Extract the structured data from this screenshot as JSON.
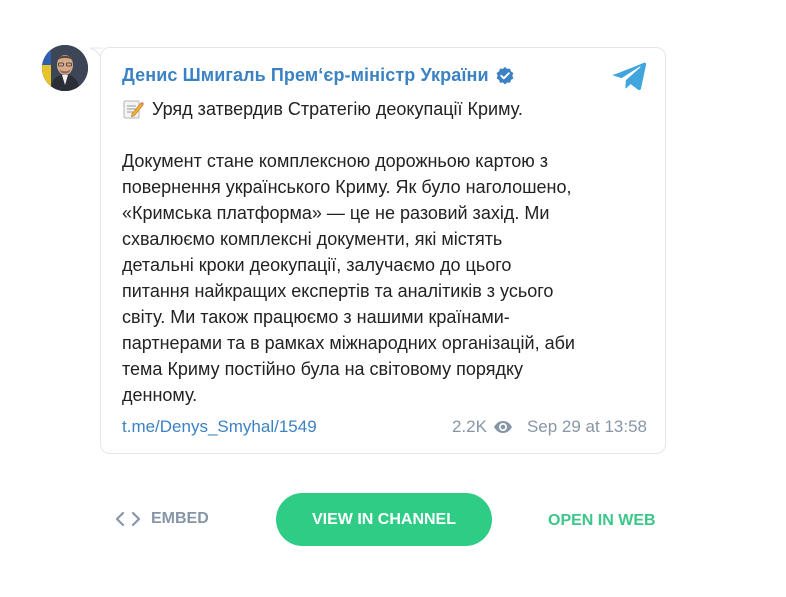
{
  "post": {
    "author": "Денис Шмигаль Прем‘єр-міністр України",
    "line1": "Уряд затвердив Стратегію деокупації Криму.",
    "body": "Документ стане комплексною дорожньою картою з\nповернення українського Криму. Як було наголошено,\n«Кримська платформа» — це не разовий захід. Ми\nсхвалюємо комплексні документи, які містять\nдетальні кроки деокупації, залучаємо до цього\nпитання найкращих експертів та аналітиків з усього\nсвіту. Ми також працюємо з нашими країнами-\nпартнерами та в рамках міжнародних організацій, аби\nтема Криму постійно була на світовому порядку\nденному.",
    "link": "t.me/Denys_Smyhal/1549",
    "views": "2.2K",
    "date": "Sep 29 at 13:58"
  },
  "actions": {
    "embed": "EMBED",
    "view_channel": "VIEW IN CHANNEL",
    "open_web": "OPEN IN WEB"
  },
  "colors": {
    "accent_blue": "#3b82c4",
    "button_green": "#2fcc86",
    "muted": "#8796a7"
  },
  "icons": [
    "avatar",
    "verified-icon",
    "telegram-logo-icon",
    "memo-icon",
    "eye-icon",
    "code-brackets-icon"
  ]
}
